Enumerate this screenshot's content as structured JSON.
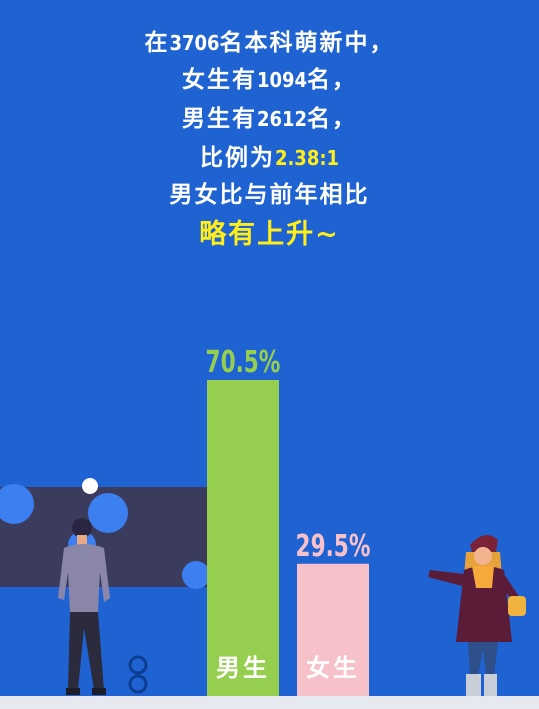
{
  "headline": {
    "line1_pre": "在",
    "line1_num": "3706",
    "line1_post": "名本科萌新中，",
    "line2_pre": "女生有",
    "line2_num": "1094",
    "line2_post": "名，",
    "line3_pre": "男生有",
    "line3_num": "2612",
    "line3_post": "名，",
    "line4_pre": "比例为",
    "line4_ratio": "2.38:1",
    "line5": "男女比与前年相比",
    "line6": "略有上升~"
  },
  "colors": {
    "background": "#1f63d3",
    "male": "#96cf4f",
    "female": "#f6c1c8",
    "highlight": "#ffee1a"
  },
  "chart_data": {
    "type": "bar",
    "categories": [
      "男生",
      "女生"
    ],
    "values": [
      70.5,
      29.5
    ],
    "value_labels": [
      "70.5%",
      "29.5%"
    ],
    "colors": [
      "#96cf4f",
      "#f6c1c8"
    ],
    "ylim": [
      0,
      100
    ],
    "title": "",
    "xlabel": "",
    "ylabel": ""
  }
}
